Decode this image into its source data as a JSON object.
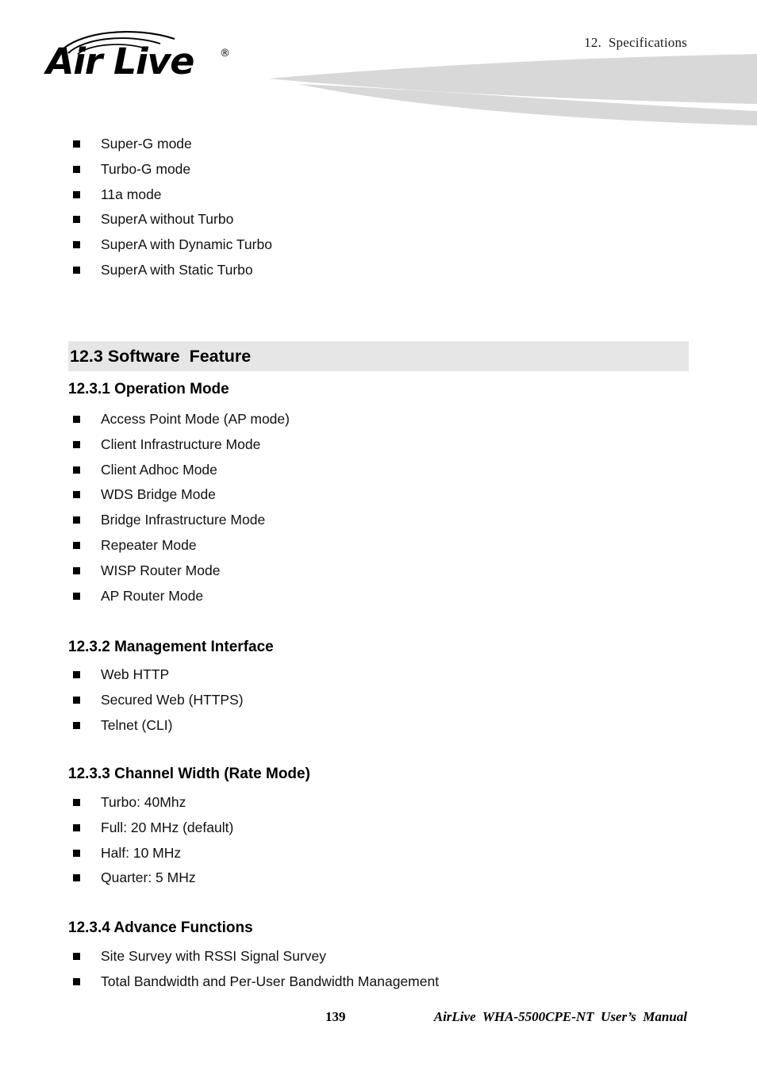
{
  "header": {
    "chapter_label": "12.  Specifications",
    "logo": {
      "word": "Air Live",
      "registered_mark": "®",
      "icon": "airlive-logo"
    },
    "swoosh_color": "#d8d8d8"
  },
  "sections": {
    "intro_modes": {
      "items": [
        "Super-G mode",
        "Turbo-G mode",
        "11a mode",
        "SuperA without Turbo",
        "SuperA with Dynamic Turbo",
        "SuperA with Static Turbo"
      ]
    },
    "software_feature": {
      "heading": "12.3 Software  Feature",
      "band_color": "#e6e6e6"
    },
    "operation_mode": {
      "heading": "12.3.1 Operation Mode",
      "items": [
        "Access Point Mode (AP mode)",
        "Client Infrastructure Mode",
        "Client Adhoc Mode",
        "WDS Bridge Mode",
        "Bridge Infrastructure Mode",
        "Repeater Mode",
        "WISP Router Mode",
        "AP Router Mode"
      ]
    },
    "management_interface": {
      "heading": "12.3.2 Management Interface",
      "items": [
        "Web HTTP",
        "Secured Web (HTTPS)",
        "Telnet (CLI)"
      ]
    },
    "channel_width": {
      "heading": "12.3.3 Channel Width (Rate Mode)",
      "items": [
        "Turbo: 40Mhz",
        "Full: 20 MHz (default)",
        "Half: 10 MHz",
        "Quarter: 5 MHz"
      ]
    },
    "advance_functions": {
      "heading": "12.3.4 Advance Functions",
      "items": [
        "Site Survey with RSSI Signal Survey",
        "Total Bandwidth and Per-User Bandwidth Management"
      ]
    }
  },
  "footer": {
    "page_number": "139",
    "manual_title": "AirLive  WHA-5500CPE-NT  User’s  Manual"
  }
}
